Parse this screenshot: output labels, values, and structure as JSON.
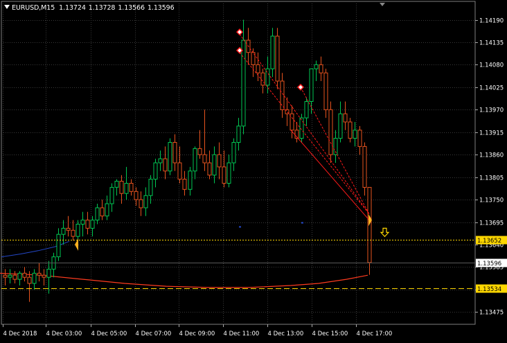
{
  "header": {
    "symbol": "EURUSD,M15",
    "open": "1.13724",
    "high": "1.13728",
    "low": "1.13566",
    "close": "1.13596"
  },
  "colors": {
    "background": "#000000",
    "grid": "#3a3a3a",
    "bull": "#00c853",
    "bear": "#e8531e",
    "axis_text": "#ffffff",
    "ma_red": "#ff3b1f",
    "ma_blue": "#2448c8",
    "level_yellow": "#ffd700",
    "trendline": "#ff1a1a",
    "current_price_box": "#ffffff",
    "arrow_marker": "#ffb020"
  },
  "chart_data": {
    "type": "candlestick",
    "symbol": "EURUSD",
    "timeframe": "M15",
    "grid": true,
    "ylim": [
      1.1344,
      1.1426
    ],
    "y_ticks": [
      "1.14190",
      "1.14135",
      "1.14080",
      "1.14025",
      "1.13970",
      "1.13915",
      "1.13860",
      "1.13805",
      "1.13750",
      "1.13695",
      "1.13640",
      "1.13585",
      "1.13530",
      "1.13475"
    ],
    "x_ticks": [
      "4 Dec 2018",
      "4 Dec 03:00",
      "4 Dec 05:00",
      "4 Dec 07:00",
      "4 Dec 09:00",
      "4 Dec 11:00",
      "4 Dec 13:00",
      "4 Dec 15:00",
      "4 Dec 17:00"
    ],
    "candles": [
      [
        1.13565,
        1.1358,
        1.1354,
        1.1356
      ],
      [
        1.1356,
        1.1358,
        1.13545,
        1.13565
      ],
      [
        1.13565,
        1.13575,
        1.13545,
        1.13555
      ],
      [
        1.13555,
        1.13575,
        1.1354,
        1.1357
      ],
      [
        1.1357,
        1.13585,
        1.1355,
        1.1356
      ],
      [
        1.1356,
        1.13575,
        1.135,
        1.13545
      ],
      [
        1.13545,
        1.1358,
        1.1353,
        1.1357
      ],
      [
        1.1357,
        1.13595,
        1.1355,
        1.13565
      ],
      [
        1.13565,
        1.1358,
        1.1354,
        1.1356
      ],
      [
        1.1356,
        1.136,
        1.1352,
        1.1358
      ],
      [
        1.1358,
        1.1362,
        1.1356,
        1.1361
      ],
      [
        1.1361,
        1.1368,
        1.136,
        1.13665
      ],
      [
        1.13665,
        1.137,
        1.1364,
        1.1368
      ],
      [
        1.1368,
        1.1371,
        1.1366,
        1.13675
      ],
      [
        1.13675,
        1.137,
        1.1365,
        1.1366
      ],
      [
        1.1366,
        1.137,
        1.1364,
        1.1369
      ],
      [
        1.1369,
        1.1372,
        1.1366,
        1.137
      ],
      [
        1.137,
        1.1372,
        1.13665,
        1.1368
      ],
      [
        1.1368,
        1.1371,
        1.1366,
        1.137
      ],
      [
        1.137,
        1.1374,
        1.1369,
        1.1373
      ],
      [
        1.1373,
        1.1375,
        1.137,
        1.1371
      ],
      [
        1.1371,
        1.1376,
        1.137,
        1.1374
      ],
      [
        1.1374,
        1.1379,
        1.1372,
        1.1378
      ],
      [
        1.1378,
        1.138,
        1.1376,
        1.13795
      ],
      [
        1.13795,
        1.1381,
        1.1374,
        1.13765
      ],
      [
        1.13765,
        1.1383,
        1.1375,
        1.1379
      ],
      [
        1.1379,
        1.138,
        1.1376,
        1.1377
      ],
      [
        1.1377,
        1.1378,
        1.13735,
        1.1375
      ],
      [
        1.1375,
        1.1377,
        1.1371,
        1.1373
      ],
      [
        1.1373,
        1.1378,
        1.1371,
        1.1376
      ],
      [
        1.1376,
        1.1381,
        1.1374,
        1.138
      ],
      [
        1.138,
        1.1385,
        1.1378,
        1.1384
      ],
      [
        1.1384,
        1.1387,
        1.1382,
        1.1385
      ],
      [
        1.1385,
        1.1388,
        1.138,
        1.1382
      ],
      [
        1.1382,
        1.139,
        1.1381,
        1.1389
      ],
      [
        1.1389,
        1.1391,
        1.1382,
        1.1384
      ],
      [
        1.1384,
        1.1388,
        1.1379,
        1.138
      ],
      [
        1.138,
        1.1382,
        1.1376,
        1.13775
      ],
      [
        1.13775,
        1.1383,
        1.1376,
        1.1382
      ],
      [
        1.1382,
        1.1388,
        1.138,
        1.13875
      ],
      [
        1.13875,
        1.1392,
        1.1385,
        1.1386
      ],
      [
        1.1386,
        1.1397,
        1.1382,
        1.1384
      ],
      [
        1.1384,
        1.1387,
        1.138,
        1.1381
      ],
      [
        1.1381,
        1.1388,
        1.1379,
        1.1386
      ],
      [
        1.1386,
        1.1389,
        1.138,
        1.1383
      ],
      [
        1.1383,
        1.1387,
        1.1378,
        1.1379
      ],
      [
        1.1379,
        1.1386,
        1.1378,
        1.1384
      ],
      [
        1.1384,
        1.139,
        1.1382,
        1.1389
      ],
      [
        1.1389,
        1.1395,
        1.1387,
        1.1393
      ],
      [
        1.1393,
        1.1419,
        1.1391,
        1.1414
      ],
      [
        1.1414,
        1.1417,
        1.1408,
        1.1411
      ],
      [
        1.1411,
        1.1412,
        1.1405,
        1.1408
      ],
      [
        1.1408,
        1.1411,
        1.1404,
        1.1406
      ],
      [
        1.1406,
        1.1407,
        1.1401,
        1.1403
      ],
      [
        1.1403,
        1.141,
        1.1401,
        1.1407
      ],
      [
        1.1407,
        1.1417,
        1.1405,
        1.1415
      ],
      [
        1.1415,
        1.1417,
        1.1402,
        1.1404
      ],
      [
        1.1404,
        1.1406,
        1.1395,
        1.1397
      ],
      [
        1.1397,
        1.14,
        1.1393,
        1.1396
      ],
      [
        1.1396,
        1.1398,
        1.139,
        1.1392
      ],
      [
        1.1392,
        1.1394,
        1.1389,
        1.139
      ],
      [
        1.139,
        1.1396,
        1.1389,
        1.1395
      ],
      [
        1.1395,
        1.14,
        1.1393,
        1.1399
      ],
      [
        1.1399,
        1.1406,
        1.1396,
        1.1407
      ],
      [
        1.1407,
        1.1409,
        1.1404,
        1.1408
      ],
      [
        1.1408,
        1.141,
        1.1404,
        1.1406
      ],
      [
        1.1406,
        1.1407,
        1.1395,
        1.1397
      ],
      [
        1.1397,
        1.1399,
        1.1384,
        1.1386
      ],
      [
        1.1386,
        1.1392,
        1.1384,
        1.139
      ],
      [
        1.139,
        1.1399,
        1.1389,
        1.1396
      ],
      [
        1.1396,
        1.1399,
        1.1392,
        1.1394
      ],
      [
        1.1394,
        1.1395,
        1.1389,
        1.139
      ],
      [
        1.139,
        1.1394,
        1.1388,
        1.1392
      ],
      [
        1.1392,
        1.1393,
        1.1386,
        1.1388
      ],
      [
        1.1388,
        1.1389,
        1.1376,
        1.1378
      ],
      [
        1.1378,
        1.13728,
        1.13566,
        1.13596
      ]
    ],
    "moving_averages": [
      {
        "color": "red",
        "values": [
          1.1357,
          1.13565,
          1.13555,
          1.13545,
          1.13538,
          1.13535,
          1.13535,
          1.1354,
          1.13545,
          1.13555,
          1.13565
        ]
      },
      {
        "color": "blue",
        "values": [
          1.1361,
          1.13617,
          1.13625,
          1.13635,
          1.13648
        ]
      }
    ],
    "horizontal_levels": [
      {
        "price": "1.13652",
        "style": "dotted"
      },
      {
        "price": "1.13534",
        "style": "dashed"
      }
    ],
    "current_price": "1.13596"
  }
}
